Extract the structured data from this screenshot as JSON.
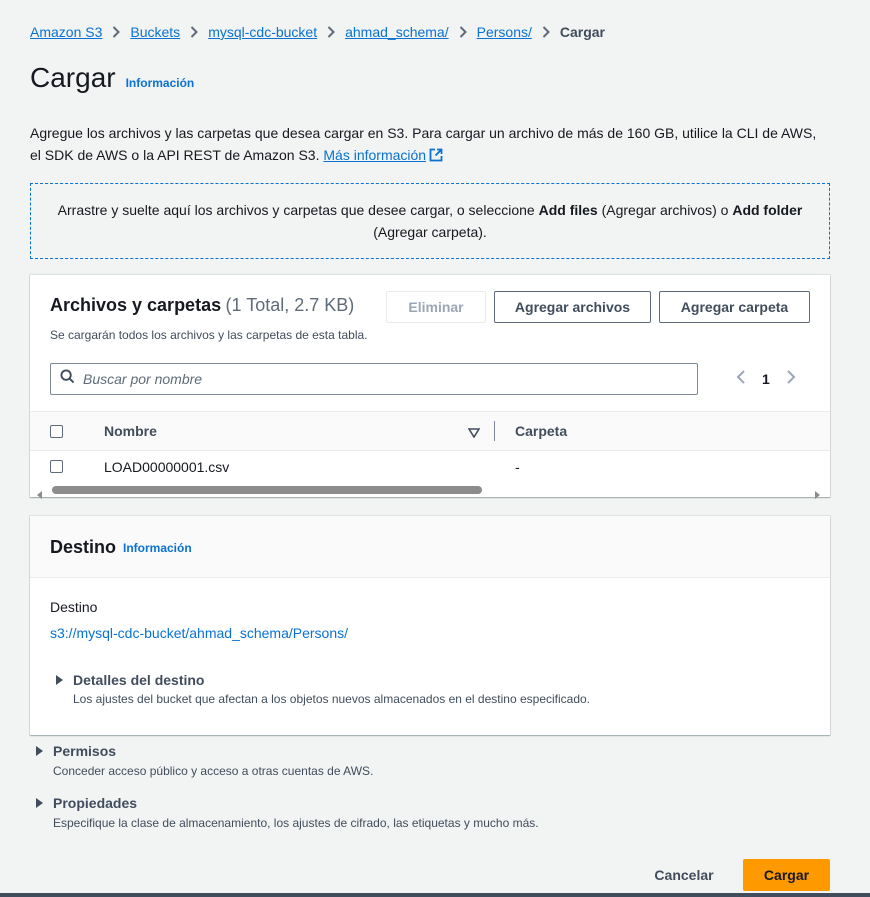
{
  "breadcrumb": {
    "items": [
      "Amazon S3",
      "Buckets",
      "mysql-cdc-bucket",
      "ahmad_schema/",
      "Persons/"
    ],
    "current": "Cargar"
  },
  "header": {
    "title": "Cargar",
    "info_label": "Información"
  },
  "description": {
    "text": "Agregue los archivos y las carpetas que desea cargar en S3. Para cargar un archivo de más de 160 GB, utilice la CLI de AWS, el SDK de AWS o la API REST de Amazon S3.",
    "more_link": "Más información"
  },
  "dropzone": {
    "before": "Arrastre y suelte aquí los archivos y carpetas que desee cargar, o seleccione ",
    "add_files": "Add files",
    "middle": " (Agregar archivos) o ",
    "add_folder": "Add folder",
    "after": " (Agregar carpeta)."
  },
  "files": {
    "title": "Archivos y carpetas",
    "count": "(1 Total, 2.7 KB)",
    "subtitle": "Se cargarán todos los archivos y las carpetas de esta tabla.",
    "remove_button": "Eliminar",
    "add_files_button": "Agregar archivos",
    "add_folder_button": "Agregar carpeta",
    "search_placeholder": "Buscar por nombre",
    "page": "1",
    "columns": [
      "Nombre",
      "Carpeta"
    ],
    "rows": [
      {
        "name": "LOAD00000001.csv",
        "folder": "-"
      }
    ]
  },
  "destination": {
    "title": "Destino",
    "info_label": "Información",
    "label": "Destino",
    "path": "s3://mysql-cdc-bucket/ahmad_schema/Persons/",
    "details_title": "Detalles del destino",
    "details_sub": "Los ajustes del bucket que afectan a los objetos nuevos almacenados en el destino especificado."
  },
  "permissions": {
    "title": "Permisos",
    "sub": "Conceder acceso público y acceso a otras cuentas de AWS."
  },
  "properties": {
    "title": "Propiedades",
    "sub": "Especifique la clase de almacenamiento, los ajustes de cifrado, las etiquetas y mucho más."
  },
  "footer": {
    "cancel": "Cancelar",
    "submit": "Cargar"
  },
  "colors": {
    "link": "#0972d3",
    "primary": "#ff9900",
    "background": "#f2f3f3"
  }
}
